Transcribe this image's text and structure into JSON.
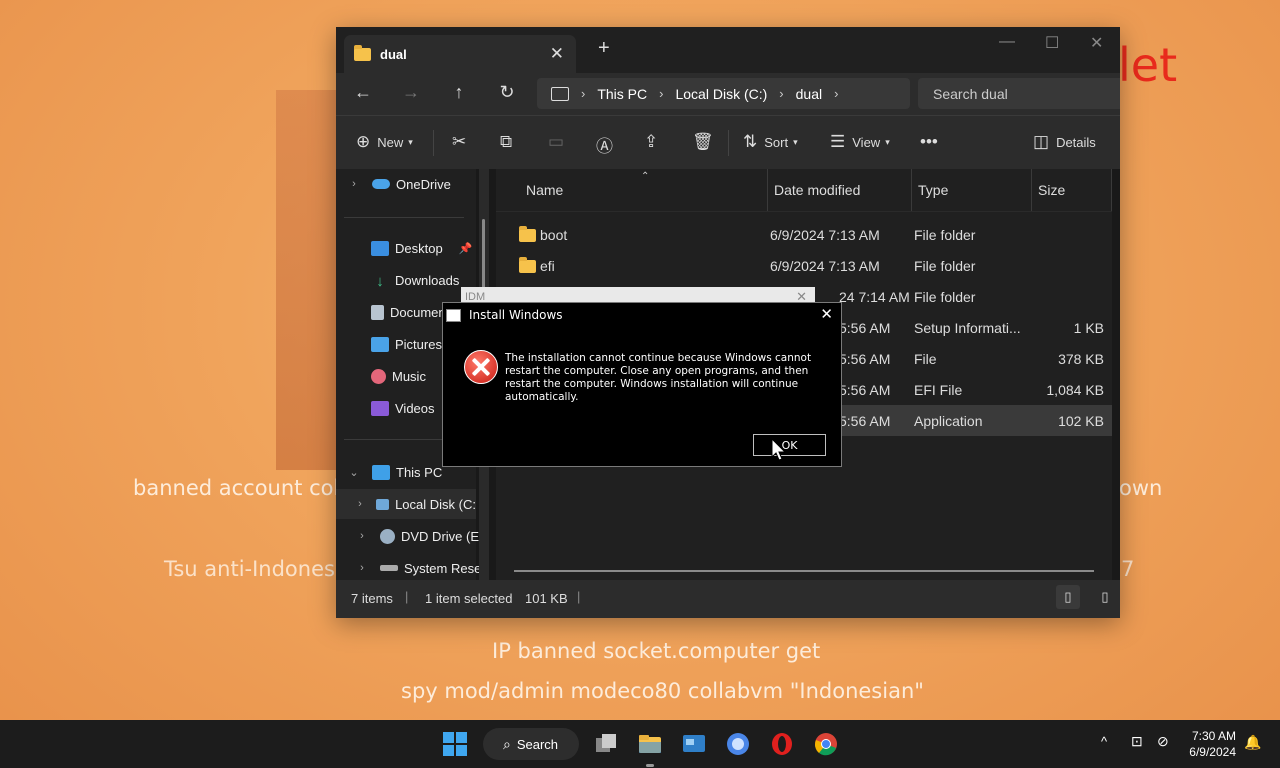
{
  "wallpaper": {
    "line1": "banned account coll",
    "line1_right": "own",
    "line2": "Tsu anti-Indonesi",
    "line2_right": "7",
    "line3": "IP banned socket.computer get",
    "line4": "spy mod/admin modeco80 collabvm \"Indonesian\"",
    "red_text": "let"
  },
  "explorer": {
    "tab_label": "dual",
    "breadcrumb": [
      "This PC",
      "Local Disk (C:)",
      "dual"
    ],
    "search_placeholder": "Search dual",
    "toolbar": {
      "new": "New",
      "sort": "Sort",
      "view": "View",
      "details": "Details"
    },
    "sidebar": {
      "onedrive": "OneDrive",
      "desktop": "Desktop",
      "downloads": "Downloads",
      "documents": "Documen",
      "pictures": "Pictures",
      "music": "Music",
      "videos": "Videos",
      "thispc": "This PC",
      "localdisk": "Local Disk (C:",
      "dvd": "DVD Drive (E:)",
      "sysres": "System Resen"
    },
    "columns": {
      "name": "Name",
      "date": "Date modified",
      "type": "Type",
      "size": "Size"
    },
    "rows": [
      {
        "name": "boot",
        "date": "6/9/2024 7:13 AM",
        "type": "File folder",
        "size": ""
      },
      {
        "name": "efi",
        "date": "6/9/2024 7:13 AM",
        "type": "File folder",
        "size": ""
      },
      {
        "name": "",
        "date": "24 7:14 AM",
        "type": "File folder",
        "size": ""
      },
      {
        "name": "",
        "date": "5:56 AM",
        "type": "Setup Informati...",
        "size": "1 KB"
      },
      {
        "name": "",
        "date": "5:56 AM",
        "type": "File",
        "size": "378 KB"
      },
      {
        "name": "",
        "date": "5:56 AM",
        "type": "EFI File",
        "size": "1,084 KB"
      },
      {
        "name": "",
        "date": "5:56 AM",
        "type": "Application",
        "size": "102 KB"
      }
    ],
    "status": {
      "items": "7 items",
      "selected": "1 item selected",
      "size": "101 KB"
    }
  },
  "ghost_window": {
    "title": "IDM"
  },
  "dialog": {
    "title": "Install Windows",
    "message": "The installation cannot continue because Windows cannot restart the computer. Close any open programs, and then restart the computer. Windows installation will continue automatically.",
    "ok": "OK"
  },
  "taskbar": {
    "search": "Search",
    "time": "7:30 AM",
    "date": "6/9/2024"
  }
}
